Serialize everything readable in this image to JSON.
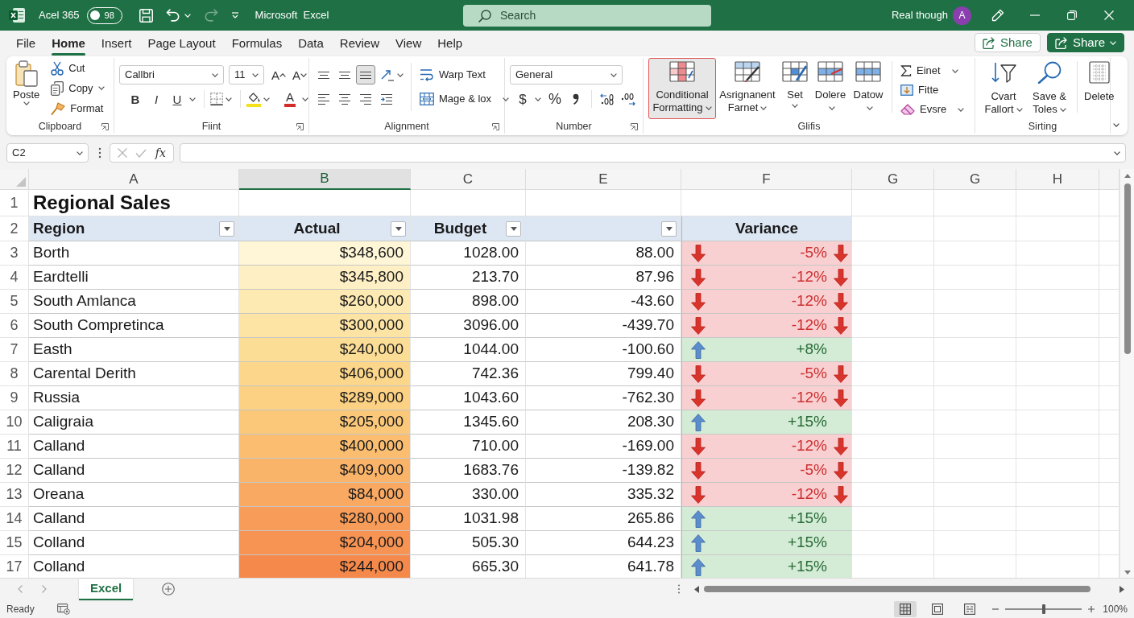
{
  "title_bar": {
    "app_label": "Acel 365",
    "autosave": {
      "label": "98",
      "on": false
    },
    "title": "Microsoft  Excel",
    "search": {
      "placeholder": "Search"
    },
    "user_name": "Real though",
    "avatar_initial": "A"
  },
  "menu_tabs": [
    {
      "label": "File",
      "selected": false
    },
    {
      "label": "Home",
      "selected": true
    },
    {
      "label": "Insert",
      "selected": false
    },
    {
      "label": "Page Layout",
      "selected": false
    },
    {
      "label": "Formulas",
      "selected": false
    },
    {
      "label": "Data",
      "selected": false
    },
    {
      "label": "Review",
      "selected": false
    },
    {
      "label": "View",
      "selected": false
    },
    {
      "label": "Help",
      "selected": false
    }
  ],
  "share_buttons": [
    {
      "label": "Share",
      "kind": "outline"
    },
    {
      "label": "Share",
      "kind": "primary"
    }
  ],
  "ribbon": {
    "clipboard": {
      "label": "Clipboard",
      "paste": "Poste",
      "cut": "Cut",
      "copy": "Copy",
      "format_painter": "Format"
    },
    "font": {
      "label": "Fiint",
      "font_name": "Callbri",
      "font_size": "11",
      "grow": "A",
      "shrink": "A",
      "bold": "B",
      "italic": "I",
      "underline": "U",
      "font_color": "A"
    },
    "alignment": {
      "label": "Alignment",
      "vertical_align": [
        {
          "selected": false
        },
        {
          "selected": false
        },
        {
          "selected": true
        }
      ],
      "wrap_text": "Warp Text",
      "merge": "Mage & lox"
    },
    "number": {
      "label": "Number",
      "format": "General",
      "currency": "$",
      "percent": "%"
    },
    "styles": {
      "label": "Glifis",
      "buttons": [
        {
          "label": "Conditional Formatting",
          "selected": true
        },
        {
          "label": "Asrignanent Farnet",
          "selected": false
        },
        {
          "label": "Set",
          "selected": false
        },
        {
          "label": "Dolere",
          "selected": false
        },
        {
          "label": "Datow",
          "selected": false
        }
      ],
      "editing": [
        "Einet",
        "Fitte",
        "Evsre"
      ]
    },
    "sorting": {
      "label": "Sirting",
      "buttons": [
        "Cvart Fallort",
        "Save & Toles"
      ],
      "delete": "Delete"
    }
  },
  "formula_bar": {
    "name_box": "C2",
    "function_button": "fx"
  },
  "sheet": {
    "columns": [
      {
        "label": "A",
        "selected": false
      },
      {
        "label": "B",
        "selected": true
      },
      {
        "label": "C",
        "selected": false
      },
      {
        "label": "E",
        "selected": false
      },
      {
        "label": "F",
        "selected": false
      },
      {
        "label": "G",
        "selected": false
      },
      {
        "label": "G",
        "selected": false
      },
      {
        "label": "H",
        "selected": false
      }
    ],
    "title": {
      "number": "1",
      "text": "Regional Sales"
    },
    "header": {
      "number": "2",
      "cells": [
        {
          "label": "Region",
          "filter": true
        },
        {
          "label": "Actual",
          "filter": true
        },
        {
          "label": "Budget",
          "filter": true
        },
        {
          "filter": true
        },
        {
          "label": "Variance",
          "filter": false
        }
      ]
    },
    "rows": [
      {
        "number": "3",
        "region": "Borth",
        "actual": {
          "text": "$348,600",
          "color": "#fef6d6"
        },
        "budget": "1028.00",
        "column_4": "88.00",
        "variance": {
          "text": "-5%",
          "kind": "down"
        }
      },
      {
        "number": "4",
        "region": "Eardtelli",
        "actual": {
          "text": "$345,800",
          "color": "#fef0c4"
        },
        "budget": "213.70",
        "column_4": "87.96",
        "variance": {
          "text": "-12%",
          "kind": "down"
        }
      },
      {
        "number": "5",
        "region": "South Amlanca",
        "actual": {
          "text": "$260,000",
          "color": "#fde9b2"
        },
        "budget": "898.00",
        "column_4": "-43.60",
        "variance": {
          "text": "-12%",
          "kind": "down"
        }
      },
      {
        "number": "6",
        "region": "South Compretinca",
        "actual": {
          "text": "$300,000",
          "color": "#fde3a4"
        },
        "budget": "3096.00",
        "column_4": "-439.70",
        "variance": {
          "text": "-12%",
          "kind": "down"
        }
      },
      {
        "number": "7",
        "region": "Easth",
        "actual": {
          "text": "$240,000",
          "color": "#fcdd96"
        },
        "budget": "1044.00",
        "column_4": "-100.60",
        "variance": {
          "text": "+8%",
          "kind": "up"
        }
      },
      {
        "number": "8",
        "region": "Carental Derith",
        "actual": {
          "text": "$406,000",
          "color": "#fcd78b"
        },
        "budget": "742.36",
        "column_4": "799.40",
        "variance": {
          "text": "-5%",
          "kind": "down"
        }
      },
      {
        "number": "9",
        "region": "Russia",
        "actual": {
          "text": "$289,000",
          "color": "#fcd183"
        },
        "budget": "1043.60",
        "column_4": "-762.30",
        "variance": {
          "text": "-12%",
          "kind": "down"
        }
      },
      {
        "number": "10",
        "region": "Caligraia",
        "actual": {
          "text": "$205,000",
          "color": "#fbc87a"
        },
        "budget": "1345.60",
        "column_4": "208.30",
        "variance": {
          "text": "+15%",
          "kind": "up"
        }
      },
      {
        "number": "11",
        "region": "Calland",
        "actual": {
          "text": "$400,000",
          "color": "#fbbe71"
        },
        "budget": "710.00",
        "column_4": "-169.00",
        "variance": {
          "text": "-12%",
          "kind": "down"
        }
      },
      {
        "number": "12",
        "region": "Calland",
        "actual": {
          "text": "$409,000",
          "color": "#fab469"
        },
        "budget": "1683.76",
        "column_4": "-139.82",
        "variance": {
          "text": "-5%",
          "kind": "down"
        }
      },
      {
        "number": "13",
        "region": "Oreana",
        "actual": {
          "text": "$84,000",
          "color": "#f9a961"
        },
        "budget": "330.00",
        "column_4": "335.32",
        "variance": {
          "text": "-12%",
          "kind": "down"
        }
      },
      {
        "number": "14",
        "region": "Calland",
        "actual": {
          "text": "$280,000",
          "color": "#f89d59"
        },
        "budget": "1031.98",
        "column_4": "265.86",
        "variance": {
          "text": "+15%",
          "kind": "up"
        }
      },
      {
        "number": "15",
        "region": "Colland",
        "actual": {
          "text": "$204,000",
          "color": "#f79353"
        },
        "budget": "505.30",
        "column_4": "644.23",
        "variance": {
          "text": "+15%",
          "kind": "up"
        }
      },
      {
        "number": "17",
        "region": "Colland",
        "actual": {
          "text": "$244,000",
          "color": "#f5894b"
        },
        "budget": "665.30",
        "column_4": "641.78",
        "variance": {
          "text": "+15%",
          "kind": "up"
        }
      }
    ]
  },
  "sheet_tabs": [
    {
      "label": "Excel",
      "selected": true
    }
  ],
  "status_bar": {
    "status": "Ready",
    "views": [
      {
        "selected": true
      },
      {
        "selected": false
      },
      {
        "selected": false
      }
    ],
    "zoom": {
      "level": 0.5,
      "reading": "100%"
    }
  }
}
